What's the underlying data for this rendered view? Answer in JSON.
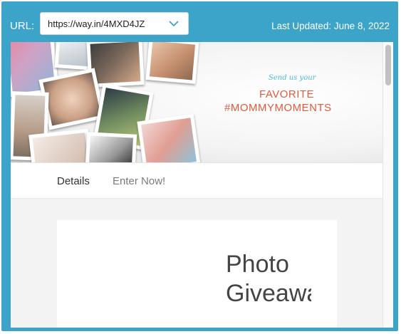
{
  "header": {
    "url_label": "URL:",
    "url_value": "https://way.in/4MXD4JZ",
    "last_updated": "Last Updated: June 8, 2022"
  },
  "banner": {
    "send_us": "Send us your",
    "line1": "FAVORITE",
    "line2": "#MOMMYMOMENTS"
  },
  "tabs": [
    {
      "label": "Details"
    },
    {
      "label": "Enter Now!"
    }
  ],
  "card": {
    "title_line1": "Photo",
    "title_line2": "Giveawa"
  },
  "colors": {
    "frame": "#3ca3c9",
    "accent_text": "#de5b3b",
    "script_text": "#4fb9d4"
  },
  "icons": {
    "dropdown": "chevron-down-icon"
  }
}
